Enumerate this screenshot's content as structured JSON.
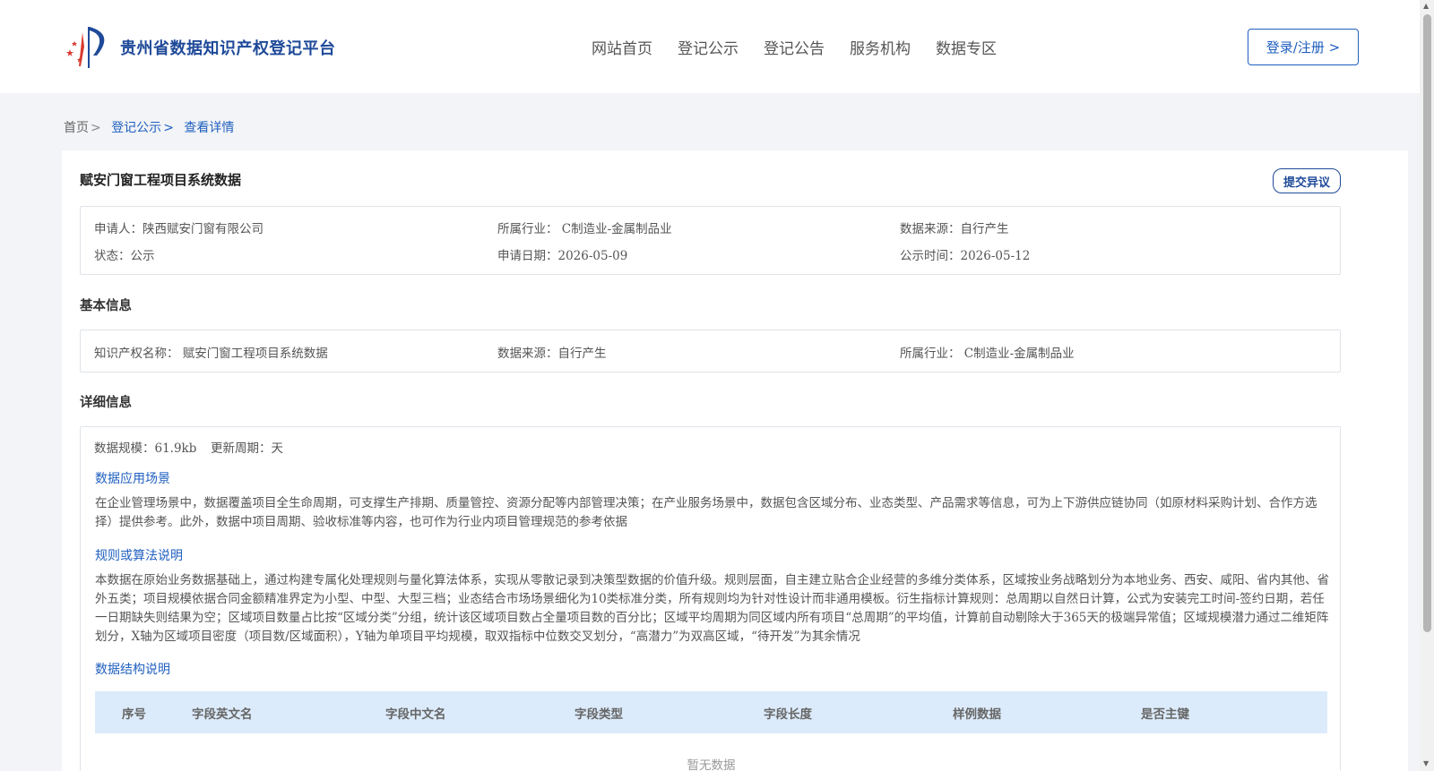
{
  "header": {
    "site_title": "贵州省数据知识产权登记平台",
    "nav": [
      "网站首页",
      "登记公示",
      "登记公告",
      "服务机构",
      "数据专区"
    ],
    "login_label": "登录/注册 >"
  },
  "breadcrumb": {
    "home": "首页",
    "section": "登记公示",
    "current": "查看详情",
    "separator": ">"
  },
  "detail": {
    "title": "赋安门窗工程项目系统数据",
    "objection_label": "提交异议",
    "summary": {
      "applicant": "申请人：陕西赋安门窗有限公司",
      "industry": "所属行业： C制造业-金属制品业",
      "source": "数据来源：自行产生",
      "status": "状态：公示",
      "apply_date": "申请日期：2026-05-09",
      "publish_date": "公示时间：2026-05-12"
    },
    "basic_title": "基本信息",
    "basic": {
      "name": "知识产权名称： 赋安门窗工程项目系统数据",
      "source": "数据来源：自行产生",
      "industry": "所属行业： C制造业-金属制品业"
    },
    "detail_title": "详细信息",
    "scale": "数据规模：61.9kb",
    "cycle": "更新周期：天",
    "scenario_title": "数据应用场景",
    "scenario_text": "在企业管理场景中，数据覆盖项目全生命周期，可支撑生产排期、质量管控、资源分配等内部管理决策；在产业服务场景中，数据包含区域分布、业态类型、产品需求等信息，可为上下游供应链协同（如原材料采购计划、合作方选择）提供参考。此外，数据中项目周期、验收标准等内容，也可作为行业内项目管理规范的参考依据",
    "rules_title": "规则或算法说明",
    "rules_text": "本数据在原始业务数据基础上，通过构建专属化处理规则与量化算法体系，实现从零散记录到决策型数据的价值升级。规则层面，自主建立贴合企业经营的多维分类体系，区域按业务战略划分为本地业务、西安、咸阳、省内其他、省外五类；项目规模依据合同金额精准界定为小型、中型、大型三档；业态结合市场场景细化为10类标准分类，所有规则均为针对性设计而非通用模板。衍生指标计算规则：总周期以自然日计算，公式为安装完工时间-签约日期，若任一日期缺失则结果为空；区域项目数量占比按“区域分类”分组，统计该区域项目数占全量项目数的百分比；区域平均周期为同区域内所有项目“总周期”的平均值，计算前自动剔除大于365天的极端异常值；区域规模潜力通过二维矩阵划分，X轴为区域项目密度（项目数/区域面积），Y轴为单项目平均规模，取双指标中位数交叉划分，“高潜力”为双高区域，“待开发”为其余情况",
    "structure_title": "数据结构说明",
    "table_headers": [
      "序号",
      "字段英文名",
      "字段中文名",
      "字段类型",
      "字段长度",
      "样例数据",
      "是否主键"
    ],
    "empty_text": "暂无数据"
  },
  "colors": {
    "accent": "#1f5fbf",
    "brand": "#1f4a99",
    "table_header_bg": "#dcebfb"
  }
}
